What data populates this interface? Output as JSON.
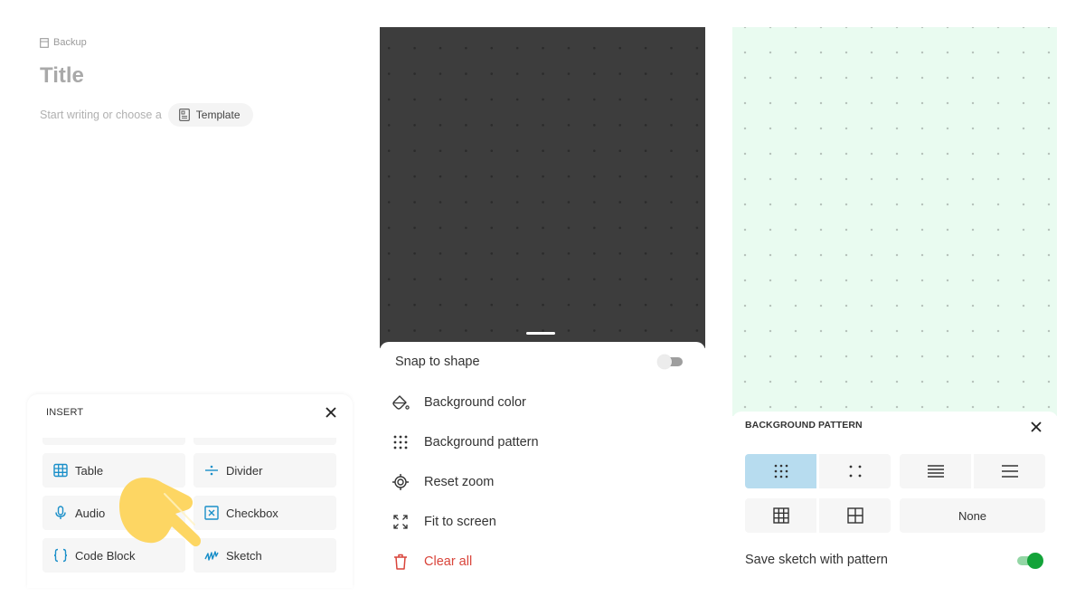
{
  "editor": {
    "breadcrumb": "Backup",
    "title_placeholder": "Title",
    "hint_text": "Start writing or choose a",
    "template_button": "Template"
  },
  "insert_sheet": {
    "heading": "INSERT",
    "items": [
      {
        "label": "Table",
        "icon": "table-icon"
      },
      {
        "label": "Divider",
        "icon": "divider-icon"
      },
      {
        "label": "Audio",
        "icon": "microphone-icon"
      },
      {
        "label": "Checkbox",
        "icon": "checkbox-icon"
      },
      {
        "label": "Code Block",
        "icon": "braces-icon"
      },
      {
        "label": "Sketch",
        "icon": "sketch-icon"
      }
    ],
    "accent_color": "#1a8fc9"
  },
  "canvas_menu": {
    "canvas_color": "#3d3d3d",
    "snap_label": "Snap to shape",
    "snap_enabled": false,
    "items": [
      {
        "label": "Background color",
        "icon": "paint-bucket-icon"
      },
      {
        "label": "Background pattern",
        "icon": "dots-grid-icon"
      },
      {
        "label": "Reset zoom",
        "icon": "target-icon"
      },
      {
        "label": "Fit to screen",
        "icon": "expand-icon"
      },
      {
        "label": "Clear all",
        "icon": "trash-icon",
        "danger": true
      }
    ],
    "danger_color": "#d9443a"
  },
  "pattern_sheet": {
    "canvas_color": "#e9fbf0",
    "heading": "BACKGROUND PATTERN",
    "options": [
      {
        "name": "dense-dots",
        "selected": true
      },
      {
        "name": "sparse-dots",
        "selected": false
      },
      {
        "name": "dense-lines",
        "selected": false
      },
      {
        "name": "sparse-lines",
        "selected": false
      },
      {
        "name": "dense-grid",
        "selected": false
      },
      {
        "name": "sparse-grid",
        "selected": false
      },
      {
        "name": "none",
        "label": "None",
        "selected": false
      }
    ],
    "save_label": "Save sketch with pattern",
    "save_enabled": true,
    "selected_color": "#b7dcef",
    "toggle_color": "#13a339"
  }
}
